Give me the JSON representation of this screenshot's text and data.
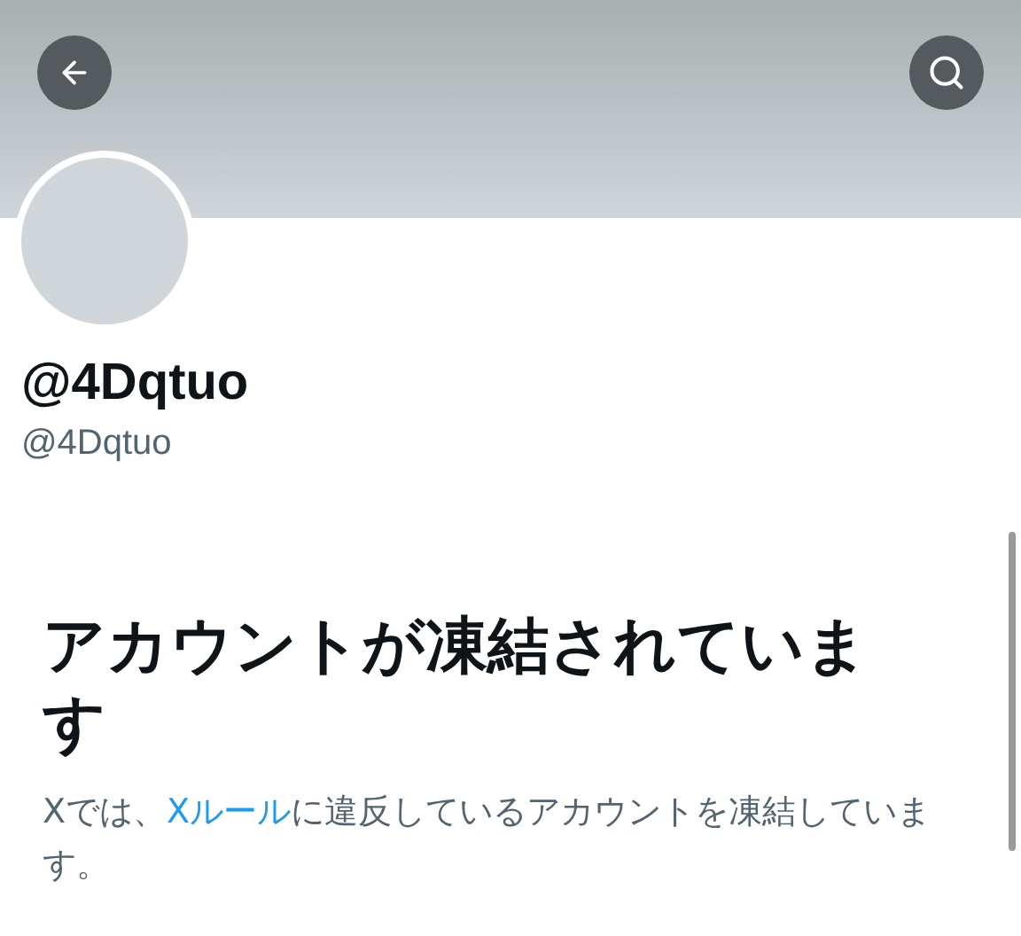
{
  "profile": {
    "display_name": "@4Dqtuo",
    "handle": "@4Dqtuo"
  },
  "notice": {
    "title": "アカウントが凍結されています",
    "body_before": "Xでは、",
    "link": "Xルール",
    "body_after": "に違反しているアカウントを凍結しています。"
  }
}
